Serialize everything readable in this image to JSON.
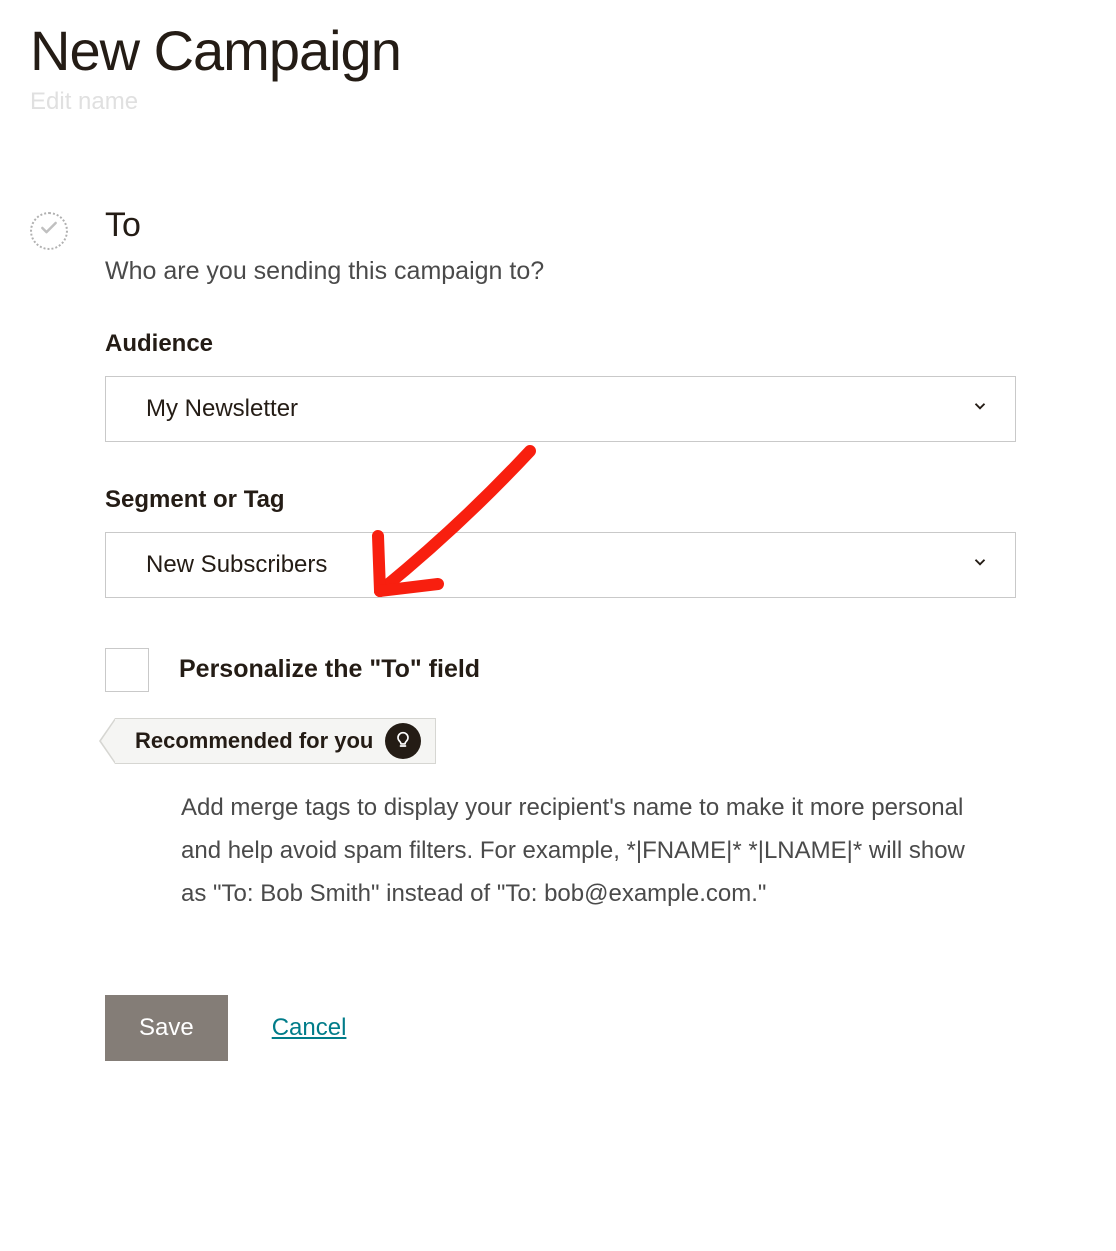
{
  "header": {
    "title": "New Campaign",
    "edit_name": "Edit name"
  },
  "to_section": {
    "heading": "To",
    "subheading": "Who are you sending this campaign to?",
    "audience_label": "Audience",
    "audience_value": "My Newsletter",
    "segment_label": "Segment or Tag",
    "segment_value": "New Subscribers",
    "personalize_label": "Personalize the \"To\" field",
    "recommended_label": "Recommended for you",
    "recommended_desc": "Add merge tags to display your recipient's name to make it more personal and help avoid spam filters. For example, *|FNAME|* *|LNAME|* will show as \"To: Bob Smith\" instead of \"To: bob@example.com.\""
  },
  "actions": {
    "save_label": "Save",
    "cancel_label": "Cancel"
  },
  "icons": {
    "check": "check-icon",
    "chevron_down": "chevron-down-icon",
    "lightbulb": "lightbulb-icon"
  },
  "annotation": {
    "arrow_color": "#f81f0f"
  }
}
